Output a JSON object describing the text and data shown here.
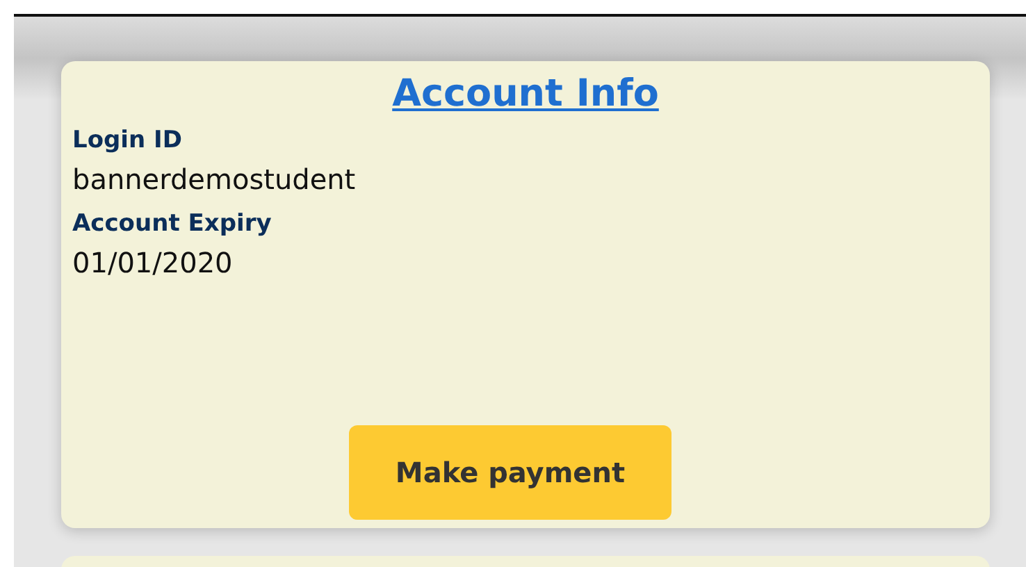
{
  "card": {
    "title": "Account Info",
    "fields": [
      {
        "label": "Login ID",
        "value": "bannerdemostudent"
      },
      {
        "label": "Account Expiry",
        "value": "01/01/2020"
      }
    ],
    "button": "Make payment"
  }
}
